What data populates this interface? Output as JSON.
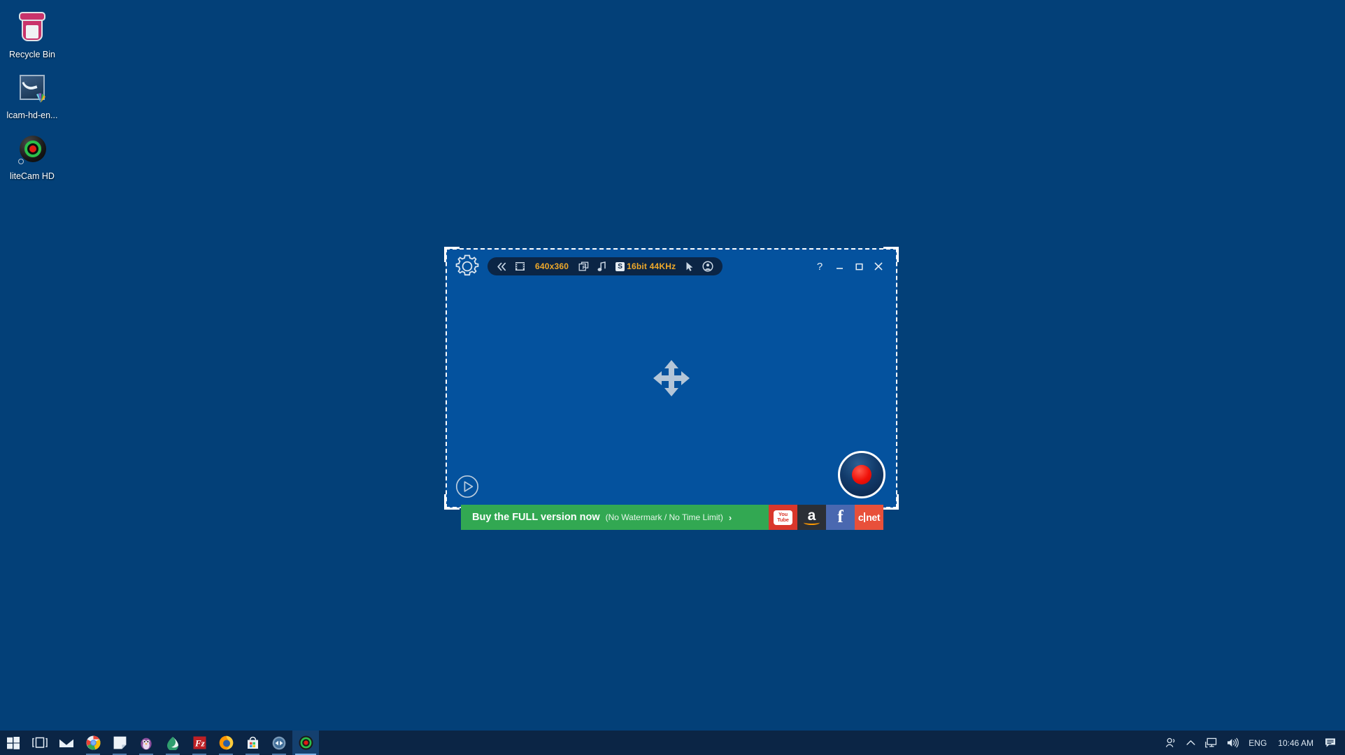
{
  "desktop": {
    "background_color": "#034078",
    "icons": [
      {
        "name": "recycle-bin",
        "label": "Recycle Bin"
      },
      {
        "name": "installer",
        "label": "lcam-hd-en..."
      },
      {
        "name": "litecam-hd",
        "label": "liteCam HD"
      }
    ]
  },
  "capture_window": {
    "toolbar": {
      "settings_icon": "gear-icon",
      "collapse_icon": "double-chevron-left-icon",
      "video_icon": "film-strip-icon",
      "resolution": "640x360",
      "frame_icon": "frame-f-icon",
      "audio_icon": "music-note-icon",
      "audio_badge": "S",
      "audio_format": "16bit 44KHz",
      "cursor_icon": "cursor-arrow-icon",
      "webcam_icon": "webcam-face-icon"
    },
    "window_controls": {
      "help": "?",
      "minimize": "—",
      "maximize": "□",
      "close": "✕"
    },
    "move_handle_icon": "move-four-arrows-icon",
    "play_button_icon": "play-circle-icon",
    "record_button_icon": "record-button-icon",
    "region_border_color": "#ffffff",
    "region_fill_color": "#04529e"
  },
  "promo_banner": {
    "main_text": "Buy the FULL version now",
    "sub_text": "(No Watermark / No Time Limit)",
    "arrow": "›",
    "background_color": "#32a852",
    "social": [
      {
        "name": "youtube",
        "line1": "You",
        "line2": "Tube",
        "color": "#d9372b"
      },
      {
        "name": "amazon",
        "glyph": "a",
        "color": "#2b2f36"
      },
      {
        "name": "facebook",
        "glyph": "f",
        "color": "#4a68b0"
      },
      {
        "name": "cnet",
        "left": "c",
        "right": "net",
        "color": "#e8503a"
      }
    ]
  },
  "taskbar": {
    "background_color": "#0b2545",
    "apps": [
      {
        "name": "start-button",
        "label": "Start"
      },
      {
        "name": "task-view",
        "label": "Task View"
      },
      {
        "name": "mail",
        "label": "Mail"
      },
      {
        "name": "chrome",
        "label": "Google Chrome"
      },
      {
        "name": "sticky-notes",
        "label": "Sticky Notes"
      },
      {
        "name": "penguin-app",
        "label": "Penguin App"
      },
      {
        "name": "maps-app",
        "label": "Maps"
      },
      {
        "name": "filezilla",
        "label": "FileZilla"
      },
      {
        "name": "firefox",
        "label": "Firefox"
      },
      {
        "name": "microsoft-store",
        "label": "Microsoft Store"
      },
      {
        "name": "teamviewer",
        "label": "TeamViewer"
      },
      {
        "name": "litecam-hd",
        "label": "liteCam HD"
      }
    ],
    "tray": {
      "people_icon": "people-icon",
      "show_hidden_icon": "chevron-up-icon",
      "network_icon": "network-monitor-icon",
      "volume_icon": "speaker-icon",
      "language": "ENG",
      "clock": "10:46 AM",
      "notifications_icon": "notifications-icon"
    }
  }
}
